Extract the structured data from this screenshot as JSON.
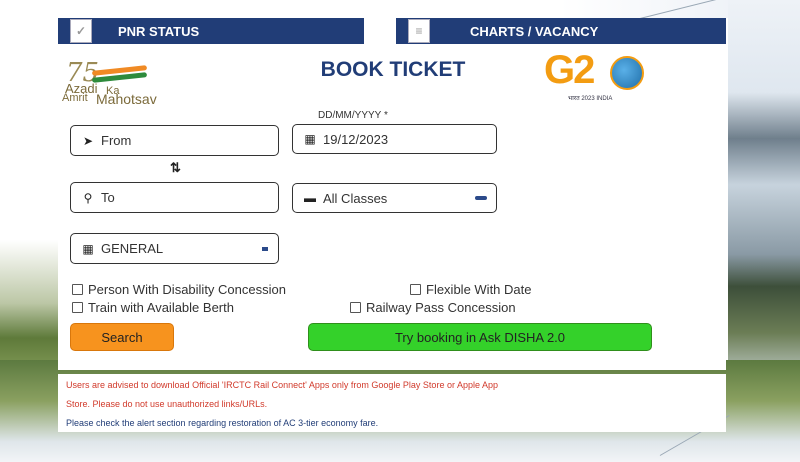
{
  "tabs": {
    "pnr_status": "PNR STATUS",
    "charts_vacancy": "CHARTS / VACANCY"
  },
  "logo_azadi": {
    "number": "75",
    "line1": "Azadi",
    "line2": "Ka",
    "line3": "Amrit",
    "line4": "Mahotsav"
  },
  "logo_g20": {
    "text": "G2",
    "caption": "भारत 2023 INDIA"
  },
  "page_title": "BOOK TICKET",
  "form": {
    "date_label": "DD/MM/YYYY *",
    "from_placeholder": "From",
    "to_placeholder": "To",
    "date_value": "19/12/2023",
    "class_value": "All Classes",
    "quota_value": "GENERAL",
    "swap_glyph": "⇅"
  },
  "options": {
    "disability": "Person With Disability Concession",
    "flexible_date": "Flexible With Date",
    "available_berth": "Train with Available Berth",
    "railway_pass": "Railway Pass Concession"
  },
  "buttons": {
    "search": "Search",
    "disha": "Try booking in Ask DISHA 2.0"
  },
  "notices": {
    "line1": "Users are advised to download Official 'IRCTC Rail Connect' Apps only from Google Play Store or Apple App",
    "line2": "Store. Please do not use unauthorized links/URLs.",
    "line3": "Please check the alert section regarding restoration of AC 3-tier economy fare."
  },
  "colors": {
    "navy": "#213d77",
    "orange": "#f7931e",
    "green": "#34d12a",
    "notice_red": "#d13a2b"
  }
}
